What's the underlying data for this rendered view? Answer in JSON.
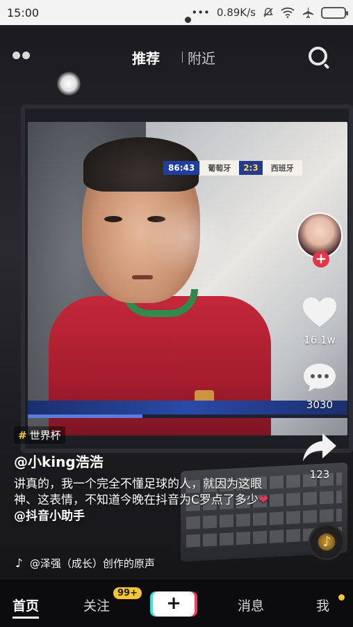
{
  "status_bar": {
    "time": "15:00",
    "network_speed": "0.89K/s",
    "icons": [
      "signal-dots-icon",
      "mute-icon",
      "wifi-icon",
      "airplane-icon",
      "battery-icon"
    ]
  },
  "top_nav": {
    "tabs": [
      {
        "label": "推荐",
        "active": true
      },
      {
        "label": "附近",
        "active": false
      }
    ],
    "icons": [
      "menu-dots-icon",
      "search-icon"
    ]
  },
  "video": {
    "scoreboard": {
      "time": "86:43",
      "team1": "葡萄牙",
      "score": "2:3",
      "team2": "西班牙"
    }
  },
  "sidebar": {
    "follow_plus": "+",
    "likes": "16.1w",
    "comments": "3030",
    "shares": "123"
  },
  "caption": {
    "topic_symbol": "#",
    "topic": "世界杯",
    "author": "@小king浩浩",
    "text": "讲真的，我一个完全不懂足球的人，就因为这眼神、这表情，不知道今晚在抖音为C罗点了多少",
    "heart": "❤",
    "mention": "@抖音小助手",
    "music_note": "♪",
    "music": "@泽强（成长）创作的原声"
  },
  "bottom_nav": {
    "home": "首页",
    "follow": "关注",
    "follow_badge": "99+",
    "create": "+",
    "messages": "消息",
    "me": "我"
  },
  "colors": {
    "accent_red": "#e8334a",
    "badge_yellow": "#f7c531",
    "cyan": "#33e6e0",
    "pink": "#f23b5e"
  }
}
